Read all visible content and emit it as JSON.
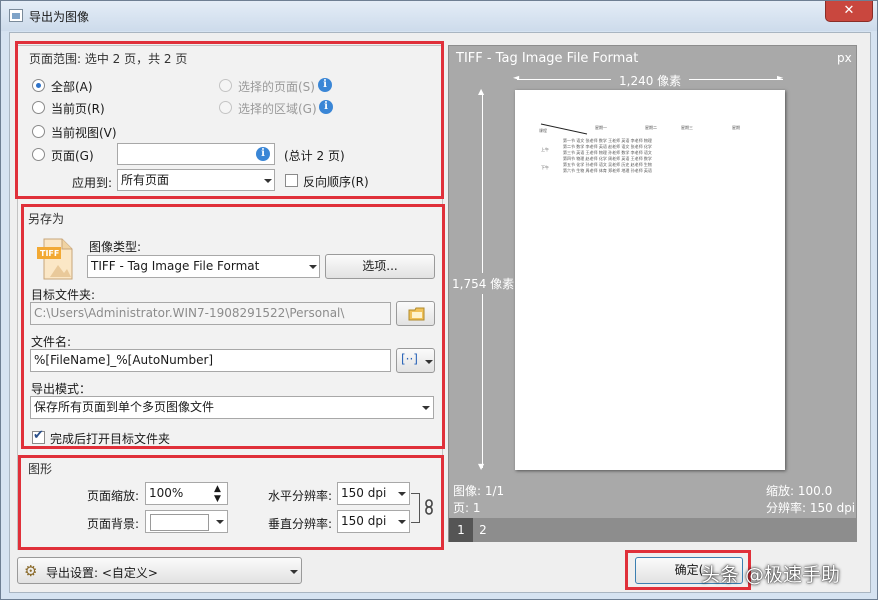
{
  "window": {
    "title": "导出为图像",
    "close_label": "✕"
  },
  "page_range": {
    "group_title": "页面范围: 选中 2 页，共 2 页",
    "options": {
      "all": "全部(A)",
      "selected_pages": "选择的页面(S)",
      "current_page": "当前页(R)",
      "selected_area": "选择的区域(G)",
      "current_view": "当前视图(V)",
      "pages": "页面(G)"
    },
    "pages_input_value": "",
    "total_text": "(总计 2 页)",
    "apply_to_label": "应用到:",
    "apply_to_value": "所有页面",
    "reverse_order_label": "反向顺序(R)",
    "reverse_order_checked": false
  },
  "save_as": {
    "group_title": "另存为",
    "file_icon_text": "TIFF",
    "image_type_label": "图像类型:",
    "image_type_value": "TIFF - Tag Image File Format",
    "options_button": "选项...",
    "target_folder_label": "目标文件夹:",
    "target_folder_value": "C:\\Users\\Administrator.WIN7-1908291522\\Personal\\",
    "filename_label": "文件名:",
    "filename_value": "%[FileName]_%[AutoNumber]",
    "export_mode_label": "导出模式：",
    "export_mode_value": "保存所有页面到单个多页图像文件",
    "open_folder_label": "完成后打开目标文件夹",
    "open_folder_checked": true
  },
  "graphics": {
    "group_title": "图形",
    "zoom_label": "页面缩放:",
    "zoom_value": "100%",
    "background_label": "页面背景:",
    "hres_label": "水平分辨率:",
    "hres_value": "150 dpi",
    "vres_label": "垂直分辨率:",
    "vres_value": "150 dpi"
  },
  "export_settings": {
    "label": "导出设置: <自定义>"
  },
  "ok_button": {
    "label": "确定("
  },
  "preview": {
    "title": "TIFF - Tag Image File Format",
    "unit": "px",
    "width_label": "1,240 像素",
    "height_label": "1,754 像素",
    "image_info": "图像: 1/1",
    "page_info": "页: 1",
    "zoom_info": "缩放: 100.0",
    "resolution_info": "分辨率: 150 dpi",
    "pages": [
      "1",
      "2"
    ],
    "selected_page": "1",
    "thumbnail_text": {
      "c1": "课程",
      "c2": "星期一",
      "c3": "星期二",
      "c4": "星期三",
      "c5": "星期",
      "r1": "第一节 语文 张老师 数学 王老师 英语 李老师 物理",
      "r2": "第二节 数学 李老师 英语 赵老师 语文 张老师 化学",
      "r3": "第三节 英语 王老师 物理 孙老师 数学 李老师 语文",
      "r4": "第四节 物理 赵老师 化学 周老师 英语 王老师 数学",
      "r5": "第五节 化学 孙老师 语文 吴老师 历史 赵老师 生物",
      "r6": "第六节 生物 周老师 体育 郑老师 地理 孙老师 英语",
      "am": "上午",
      "pm": "下午"
    }
  },
  "watermark": {
    "text": "头条 @极速手助"
  }
}
